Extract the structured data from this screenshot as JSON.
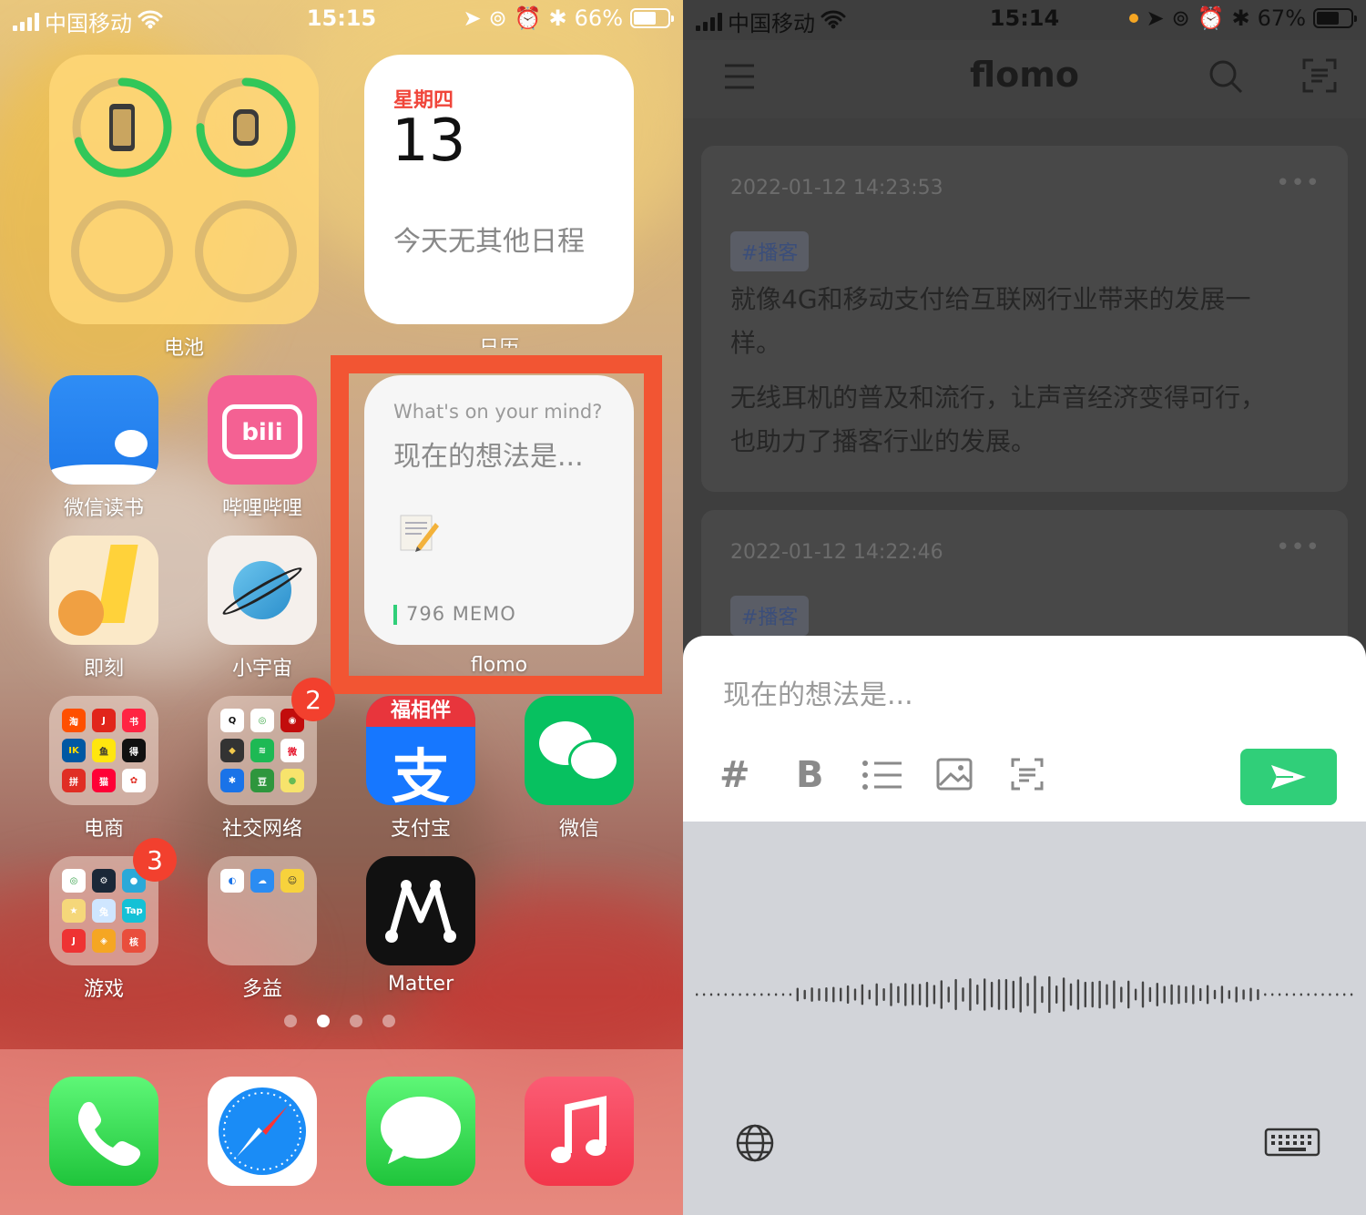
{
  "left": {
    "status": {
      "carrier": "中国移动",
      "time": "15:15",
      "battery_text": "66%",
      "battery_level": 0.66
    },
    "battery_widget": {
      "label": "电池",
      "phone_level": 0.7,
      "watch_level": 0.75
    },
    "calendar_widget": {
      "weekday": "星期四",
      "day": "13",
      "note": "今天无其他日程",
      "label": "日历"
    },
    "flomo_widget": {
      "prompt": "What's on your mind?",
      "placeholder": "现在的想法是...",
      "count": "796 MEMO",
      "label": "flomo",
      "highlight_color": "#f25533"
    },
    "apps": [
      {
        "name": "微信读书",
        "icon": "wechat-read-icon"
      },
      {
        "name": "哔哩哔哩",
        "icon": "bilibili-icon"
      },
      {
        "name": "即刻",
        "icon": "jike-icon"
      },
      {
        "name": "小宇宙",
        "icon": "xiaoyuzhou-icon"
      },
      {
        "name": "电商",
        "icon": "folder-icon"
      },
      {
        "name": "社交网络",
        "icon": "folder-icon",
        "badge": "2"
      },
      {
        "name": "支付宝",
        "icon": "alipay-icon"
      },
      {
        "name": "微信",
        "icon": "wechat-icon"
      },
      {
        "name": "游戏",
        "icon": "folder-icon",
        "badge": "3"
      },
      {
        "name": "多益",
        "icon": "folder-icon"
      },
      {
        "name": "Matter",
        "icon": "matter-icon"
      }
    ],
    "alipay_banner": "福相伴",
    "dock": [
      "phone-icon",
      "safari-icon",
      "messages-icon",
      "music-icon"
    ],
    "page_dots": {
      "count": 4,
      "active": 1
    }
  },
  "right": {
    "status": {
      "carrier": "中国移动",
      "time": "15:14",
      "battery_text": "67%",
      "battery_level": 0.67
    },
    "app_title": "flomo",
    "memos": [
      {
        "time": "2022-01-12 14:23:53",
        "tag": "#播客",
        "text": [
          "就像4G和移动支付给互联网行业带来的发展一",
          "样。",
          "无线耳机的普及和流行，让声音经济变得可行，",
          "也助力了播客行业的发展。"
        ]
      },
      {
        "time": "2022-01-12 14:22:46",
        "tag": "#播客"
      }
    ],
    "editor": {
      "placeholder": "现在的想法是...",
      "tools": [
        "#",
        "B"
      ]
    },
    "accent": "#30cf79"
  }
}
